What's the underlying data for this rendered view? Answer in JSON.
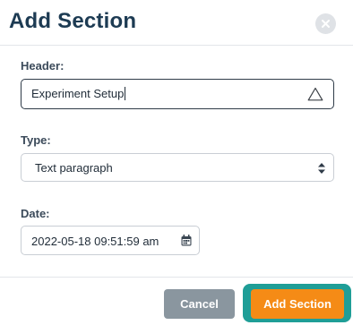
{
  "dialog": {
    "title": "Add Section",
    "close_icon": "close-circle-icon"
  },
  "fields": {
    "header": {
      "label": "Header:",
      "value": "Experiment Setup",
      "status_icon": "warning-triangle-icon"
    },
    "type": {
      "label": "Type:",
      "selected": "Text paragraph",
      "icon": "updown-caret-icon"
    },
    "date": {
      "label": "Date:",
      "value": "2022-05-18 09:51:59 am",
      "icon": "calendar-icon"
    }
  },
  "buttons": {
    "cancel": "Cancel",
    "add_section": "Add Section"
  },
  "colors": {
    "title": "#1d3b53",
    "cancel_bg": "#8a969f",
    "add_bg": "#f58b16",
    "focus_ring": "#1f9e97"
  }
}
